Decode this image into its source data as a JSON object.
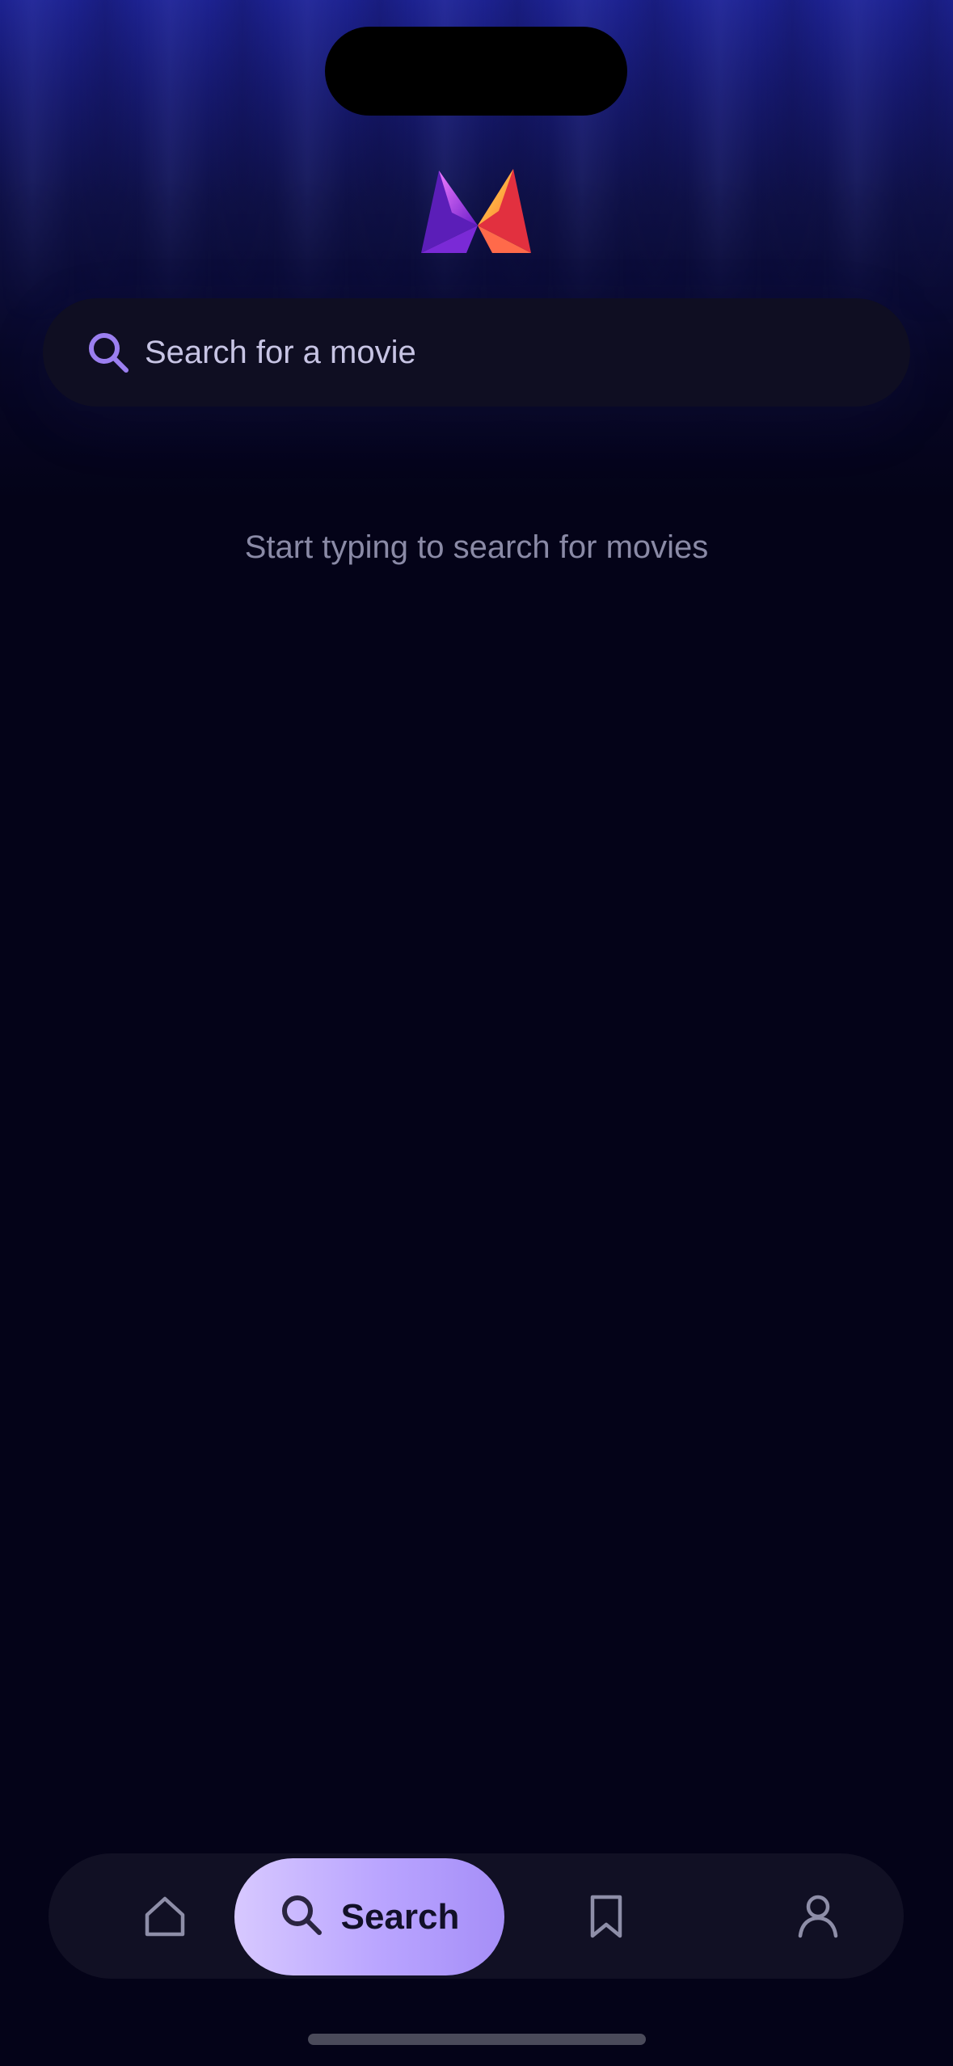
{
  "search": {
    "placeholder": "Search for a movie"
  },
  "empty_state": {
    "message": "Start typing to search for movies"
  },
  "tabbar": {
    "items": [
      {
        "id": "home",
        "icon": "home-icon",
        "label": ""
      },
      {
        "id": "search",
        "icon": "search-icon",
        "label": "Search",
        "active": true
      },
      {
        "id": "saved",
        "icon": "bookmark-icon",
        "label": ""
      },
      {
        "id": "profile",
        "icon": "user-icon",
        "label": ""
      }
    ]
  },
  "colors": {
    "background": "#040318",
    "accent": "#b9a4ff",
    "search_icon": "#9b7ff0"
  },
  "logo": {
    "icon": "app-logo-icon"
  }
}
